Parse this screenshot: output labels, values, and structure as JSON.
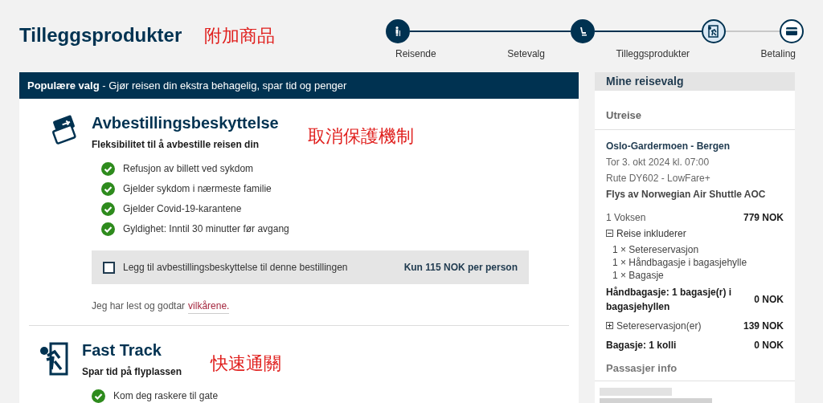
{
  "page_title": "Tilleggsprodukter",
  "title_annotation": "附加商品",
  "steps": [
    {
      "label": "Reisende",
      "done": true,
      "selected": false,
      "kind": "traveller"
    },
    {
      "label": "Setevalg",
      "done": true,
      "selected": false,
      "kind": "seat"
    },
    {
      "label": "Tilleggsprodukter",
      "done": false,
      "selected": true,
      "kind": "extras"
    },
    {
      "label": "Betaling",
      "done": false,
      "selected": false,
      "kind": "card"
    }
  ],
  "banner": "**Populære valg** - Gjør reisen din ekstra behagelig, spar tid og penger",
  "products": [
    {
      "kind": "cancellation",
      "title": "Avbestillingsbeskyttelse",
      "annotation": "取消保護機制",
      "subtitle": "Fleksibilitet til å avbestille reisen din",
      "benefits": [
        "Refusjon av billett ved sykdom",
        "Gjelder sykdom i nærmeste familie",
        "Gjelder Covid-19-karantene",
        "Gyldighet: Inntil 30 minutter før avgang"
      ],
      "option": {
        "label": "Legg til avbestillingsbeskyttelse til denne bestillingen",
        "price": "Kun 115 NOK per person",
        "checked": false
      },
      "terms_text": "Jeg har lest og godtar",
      "terms_link": "vilkårene."
    },
    {
      "kind": "fast_track",
      "title": "Fast Track",
      "annotation": "快速通關",
      "subtitle": "Spar tid på flyplassen",
      "benefits": [
        "Kom deg raskere til gate"
      ]
    }
  ],
  "summary": {
    "title": "Mine reisevalg",
    "section": "Utreise",
    "route": "Oslo-Gardermoen - Bergen",
    "date": "Tor 3. okt 2024 kl. 07:00",
    "flight": "Rute DY602 - LowFare+",
    "operator": "Flys av Norwegian Air Shuttle AOC",
    "passenger": {
      "label": "1 Voksen",
      "amount": "779 NOK"
    },
    "includes": {
      "label": "Reise inkluderer",
      "expanded": true,
      "items": [
        "1 × Setereservasjon",
        "1 × Håndbagasje i bagasjehylle",
        "1 × Bagasje"
      ]
    },
    "lines": [
      {
        "kind": "plain",
        "label": "Håndbagasje: 1 bagasje(r) i bagasjehyllen",
        "amount": "0 NOK"
      },
      {
        "kind": "expander",
        "label": "Setereservasjon(er)",
        "amount": "139 NOK",
        "expanded": false
      },
      {
        "kind": "plain",
        "label": "Bagasje: 1 kolli",
        "amount": "0 NOK"
      }
    ],
    "passenger_info": "Passasjer info"
  }
}
